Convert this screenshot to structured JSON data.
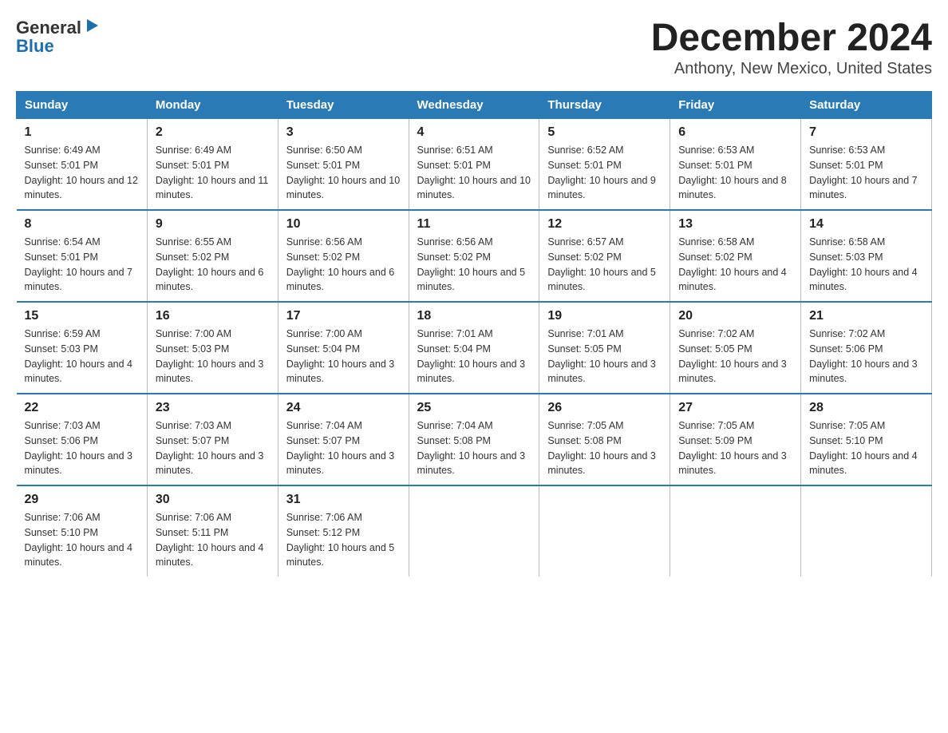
{
  "logo": {
    "general": "General",
    "blue": "Blue",
    "arrow": "▶"
  },
  "title": "December 2024",
  "location": "Anthony, New Mexico, United States",
  "days_header": [
    "Sunday",
    "Monday",
    "Tuesday",
    "Wednesday",
    "Thursday",
    "Friday",
    "Saturday"
  ],
  "weeks": [
    [
      {
        "num": "1",
        "sunrise": "6:49 AM",
        "sunset": "5:01 PM",
        "daylight": "10 hours and 12 minutes."
      },
      {
        "num": "2",
        "sunrise": "6:49 AM",
        "sunset": "5:01 PM",
        "daylight": "10 hours and 11 minutes."
      },
      {
        "num": "3",
        "sunrise": "6:50 AM",
        "sunset": "5:01 PM",
        "daylight": "10 hours and 10 minutes."
      },
      {
        "num": "4",
        "sunrise": "6:51 AM",
        "sunset": "5:01 PM",
        "daylight": "10 hours and 10 minutes."
      },
      {
        "num": "5",
        "sunrise": "6:52 AM",
        "sunset": "5:01 PM",
        "daylight": "10 hours and 9 minutes."
      },
      {
        "num": "6",
        "sunrise": "6:53 AM",
        "sunset": "5:01 PM",
        "daylight": "10 hours and 8 minutes."
      },
      {
        "num": "7",
        "sunrise": "6:53 AM",
        "sunset": "5:01 PM",
        "daylight": "10 hours and 7 minutes."
      }
    ],
    [
      {
        "num": "8",
        "sunrise": "6:54 AM",
        "sunset": "5:01 PM",
        "daylight": "10 hours and 7 minutes."
      },
      {
        "num": "9",
        "sunrise": "6:55 AM",
        "sunset": "5:02 PM",
        "daylight": "10 hours and 6 minutes."
      },
      {
        "num": "10",
        "sunrise": "6:56 AM",
        "sunset": "5:02 PM",
        "daylight": "10 hours and 6 minutes."
      },
      {
        "num": "11",
        "sunrise": "6:56 AM",
        "sunset": "5:02 PM",
        "daylight": "10 hours and 5 minutes."
      },
      {
        "num": "12",
        "sunrise": "6:57 AM",
        "sunset": "5:02 PM",
        "daylight": "10 hours and 5 minutes."
      },
      {
        "num": "13",
        "sunrise": "6:58 AM",
        "sunset": "5:02 PM",
        "daylight": "10 hours and 4 minutes."
      },
      {
        "num": "14",
        "sunrise": "6:58 AM",
        "sunset": "5:03 PM",
        "daylight": "10 hours and 4 minutes."
      }
    ],
    [
      {
        "num": "15",
        "sunrise": "6:59 AM",
        "sunset": "5:03 PM",
        "daylight": "10 hours and 4 minutes."
      },
      {
        "num": "16",
        "sunrise": "7:00 AM",
        "sunset": "5:03 PM",
        "daylight": "10 hours and 3 minutes."
      },
      {
        "num": "17",
        "sunrise": "7:00 AM",
        "sunset": "5:04 PM",
        "daylight": "10 hours and 3 minutes."
      },
      {
        "num": "18",
        "sunrise": "7:01 AM",
        "sunset": "5:04 PM",
        "daylight": "10 hours and 3 minutes."
      },
      {
        "num": "19",
        "sunrise": "7:01 AM",
        "sunset": "5:05 PM",
        "daylight": "10 hours and 3 minutes."
      },
      {
        "num": "20",
        "sunrise": "7:02 AM",
        "sunset": "5:05 PM",
        "daylight": "10 hours and 3 minutes."
      },
      {
        "num": "21",
        "sunrise": "7:02 AM",
        "sunset": "5:06 PM",
        "daylight": "10 hours and 3 minutes."
      }
    ],
    [
      {
        "num": "22",
        "sunrise": "7:03 AM",
        "sunset": "5:06 PM",
        "daylight": "10 hours and 3 minutes."
      },
      {
        "num": "23",
        "sunrise": "7:03 AM",
        "sunset": "5:07 PM",
        "daylight": "10 hours and 3 minutes."
      },
      {
        "num": "24",
        "sunrise": "7:04 AM",
        "sunset": "5:07 PM",
        "daylight": "10 hours and 3 minutes."
      },
      {
        "num": "25",
        "sunrise": "7:04 AM",
        "sunset": "5:08 PM",
        "daylight": "10 hours and 3 minutes."
      },
      {
        "num": "26",
        "sunrise": "7:05 AM",
        "sunset": "5:08 PM",
        "daylight": "10 hours and 3 minutes."
      },
      {
        "num": "27",
        "sunrise": "7:05 AM",
        "sunset": "5:09 PM",
        "daylight": "10 hours and 3 minutes."
      },
      {
        "num": "28",
        "sunrise": "7:05 AM",
        "sunset": "5:10 PM",
        "daylight": "10 hours and 4 minutes."
      }
    ],
    [
      {
        "num": "29",
        "sunrise": "7:06 AM",
        "sunset": "5:10 PM",
        "daylight": "10 hours and 4 minutes."
      },
      {
        "num": "30",
        "sunrise": "7:06 AM",
        "sunset": "5:11 PM",
        "daylight": "10 hours and 4 minutes."
      },
      {
        "num": "31",
        "sunrise": "7:06 AM",
        "sunset": "5:12 PM",
        "daylight": "10 hours and 5 minutes."
      },
      null,
      null,
      null,
      null
    ]
  ]
}
